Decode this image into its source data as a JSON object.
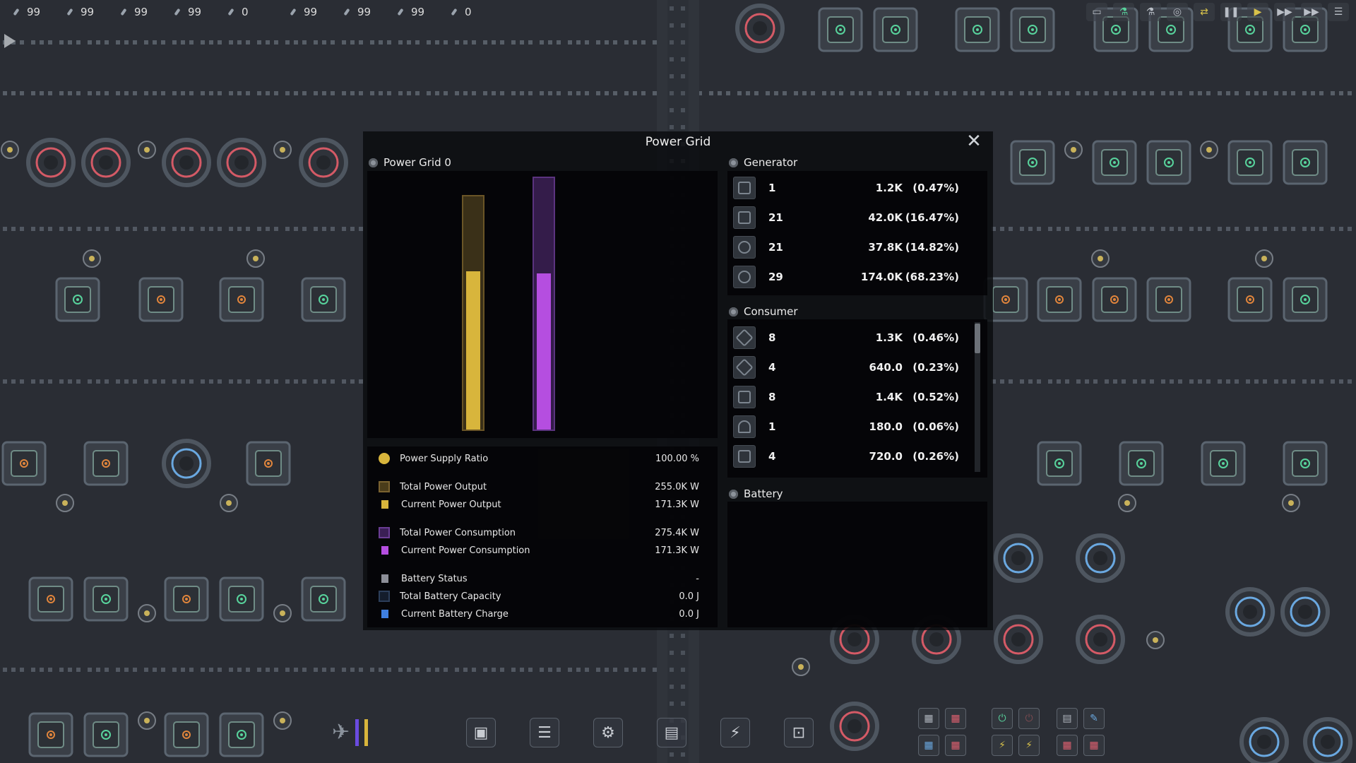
{
  "resources": [
    {
      "icon": "resource-icon",
      "value": "99"
    },
    {
      "icon": "resource-icon",
      "value": "99"
    },
    {
      "icon": "resource-icon",
      "value": "99"
    },
    {
      "icon": "resource-icon",
      "value": "99"
    },
    {
      "icon": "resource-icon",
      "value": "0"
    },
    {
      "icon": "resource-icon",
      "value": "99"
    },
    {
      "icon": "resource-icon",
      "value": "99"
    },
    {
      "icon": "resource-icon",
      "value": "99"
    },
    {
      "icon": "resource-icon",
      "value": "0"
    }
  ],
  "panel": {
    "title": "Power Grid",
    "grid_name": "Power Grid 0",
    "bars": {
      "output": {
        "total_color": "#5a4a22",
        "current_color": "#d8b53c",
        "current_fraction": 0.68
      },
      "consumption": {
        "total_color": "#4a2a6a",
        "current_color": "#b54ee0",
        "current_fraction": 0.62
      }
    },
    "stats": {
      "supply_ratio_label": "Power Supply Ratio",
      "supply_ratio_value": "100.00 %",
      "total_output_label": "Total Power Output",
      "total_output_value": "255.0K W",
      "current_output_label": "Current Power Output",
      "current_output_value": "171.3K W",
      "total_consumption_label": "Total Power Consumption",
      "total_consumption_value": "275.4K W",
      "current_consumption_label": "Current Power Consumption",
      "current_consumption_value": "171.3K W",
      "battery_status_label": "Battery Status",
      "battery_status_value": "-",
      "total_battery_label": "Total Battery Capacity",
      "total_battery_value": "0.0 J",
      "current_battery_label": "Current Battery Charge",
      "current_battery_value": "0.0 J"
    },
    "generator_title": "Generator",
    "generators": [
      {
        "count": "1",
        "amount": "1.2K",
        "percent": "(0.47%)"
      },
      {
        "count": "21",
        "amount": "42.0K",
        "percent": "(16.47%)"
      },
      {
        "count": "21",
        "amount": "37.8K",
        "percent": "(14.82%)"
      },
      {
        "count": "29",
        "amount": "174.0K",
        "percent": "(68.23%)"
      }
    ],
    "consumer_title": "Consumer",
    "consumers": [
      {
        "count": "8",
        "amount": "1.3K",
        "percent": "(0.46%)"
      },
      {
        "count": "4",
        "amount": "640.0",
        "percent": "(0.23%)"
      },
      {
        "count": "8",
        "amount": "1.4K",
        "percent": "(0.52%)"
      },
      {
        "count": "1",
        "amount": "180.0",
        "percent": "(0.06%)"
      },
      {
        "count": "4",
        "amount": "720.0",
        "percent": "(0.26%)"
      }
    ],
    "battery_title": "Battery"
  },
  "colors": {
    "supply_ratio": "#d8b53c",
    "total_output": "#6a5526",
    "current_output": "#d8b53c",
    "total_consumption": "#4d2b6e",
    "current_consumption": "#b54ee0",
    "battery_status": "#8d8f98",
    "total_battery": "#1c2a40",
    "current_battery": "#3f7fe0"
  }
}
